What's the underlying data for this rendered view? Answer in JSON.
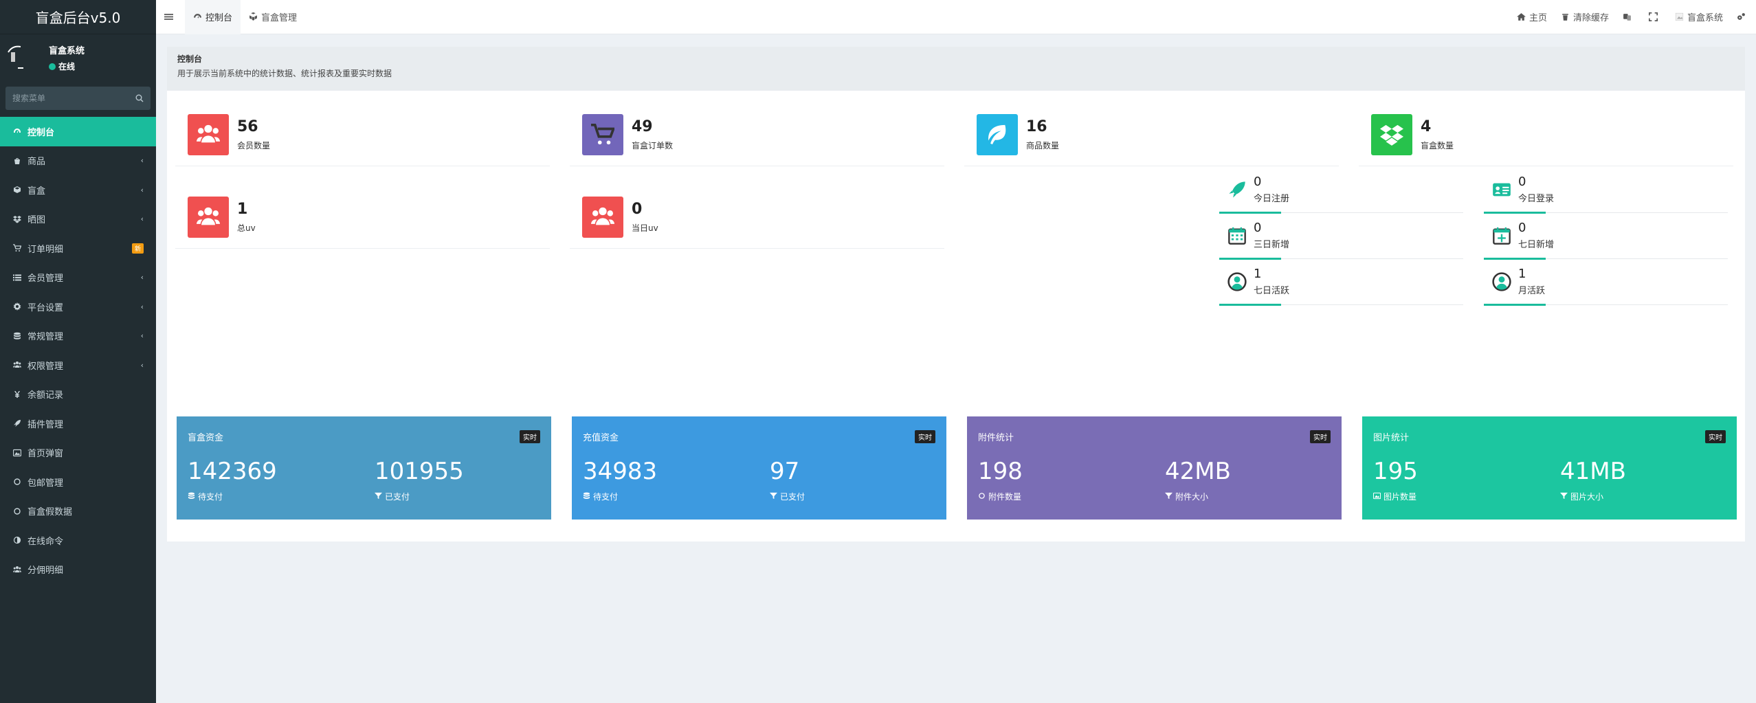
{
  "app": {
    "title": "盲盒后台v5.0"
  },
  "user": {
    "name": "盲盒系统",
    "status": "在线"
  },
  "search": {
    "placeholder": "搜索菜单"
  },
  "sidebar": {
    "items": [
      {
        "label": "控制台",
        "icon": "dashboard-icon",
        "active": true
      },
      {
        "label": "商品",
        "icon": "shopping-bag-icon",
        "has_children": true
      },
      {
        "label": "盲盒",
        "icon": "cube-icon",
        "has_children": true
      },
      {
        "label": "晒图",
        "icon": "dropbox-icon",
        "has_children": true
      },
      {
        "label": "订单明细",
        "icon": "cart-icon",
        "badge": "新"
      },
      {
        "label": "会员管理",
        "icon": "list-icon",
        "has_children": true
      },
      {
        "label": "平台设置",
        "icon": "gear-icon",
        "has_children": true
      },
      {
        "label": "常规管理",
        "icon": "database-icon",
        "has_children": true
      },
      {
        "label": "权限管理",
        "icon": "users-icon",
        "has_children": true
      },
      {
        "label": "余额记录",
        "icon": "yen-icon"
      },
      {
        "label": "插件管理",
        "icon": "rocket-icon"
      },
      {
        "label": "首页弹窗",
        "icon": "image-icon"
      },
      {
        "label": "包邮管理",
        "icon": "circle-icon"
      },
      {
        "label": "盲盒假数据",
        "icon": "circle-icon"
      },
      {
        "label": "在线命令",
        "icon": "half-circle-icon"
      },
      {
        "label": "分佣明细",
        "icon": "users-icon"
      }
    ]
  },
  "topbar": {
    "tabs": [
      {
        "label": "控制台",
        "icon": "dashboard-icon",
        "active": true
      },
      {
        "label": "盲盒管理",
        "icon": "cubes-icon"
      }
    ],
    "home_label": "主页",
    "clear_cache_label": "清除缓存",
    "user_label": "盲盒系统"
  },
  "page": {
    "title": "控制台",
    "description": "用于展示当前系统中的统计数据、统计报表及重要实时数据"
  },
  "stats": [
    {
      "value": "56",
      "label": "会员数量",
      "color": "#f05050",
      "icon": "users-icon"
    },
    {
      "value": "49",
      "label": "盲盒订单数",
      "color": "#7266ba",
      "icon": "cart-icon"
    },
    {
      "value": "16",
      "label": "商品数量",
      "color": "#23b7e5",
      "icon": "leaf-icon"
    },
    {
      "value": "4",
      "label": "盲盒数量",
      "color": "#27c24c",
      "icon": "dropbox-icon"
    },
    {
      "value": "1",
      "label": "总uv",
      "color": "#f05050",
      "icon": "users-icon"
    },
    {
      "value": "0",
      "label": "当日uv",
      "color": "#f05050",
      "icon": "users-icon"
    }
  ],
  "mini_stats": [
    {
      "value": "0",
      "label": "今日注册",
      "icon": "rocket-icon"
    },
    {
      "value": "0",
      "label": "今日登录",
      "icon": "id-card-icon"
    },
    {
      "value": "0",
      "label": "三日新增",
      "icon": "calendar-icon"
    },
    {
      "value": "0",
      "label": "七日新增",
      "icon": "calendar-plus-icon"
    },
    {
      "value": "1",
      "label": "七日活跃",
      "icon": "user-circle-icon"
    },
    {
      "value": "1",
      "label": "月活跃",
      "icon": "user-circle-icon"
    }
  ],
  "cards": [
    {
      "title": "盲盒资金",
      "tag": "实时",
      "color": "#4b9bc5",
      "v1": "142369",
      "l1": "待支付",
      "v2": "101955",
      "l2": "已支付"
    },
    {
      "title": "充值资金",
      "tag": "实时",
      "color": "#3d9ae0",
      "v1": "34983",
      "l1": "待支付",
      "v2": "97",
      "l2": "已支付"
    },
    {
      "title": "附件统计",
      "tag": "实时",
      "color": "#7a6db5",
      "v1": "198",
      "l1": "附件数量",
      "v2": "42MB",
      "l2": "附件大小"
    },
    {
      "title": "图片统计",
      "tag": "实时",
      "color": "#1cc6a0",
      "v1": "195",
      "l1": "图片数量",
      "v2": "41MB",
      "l2": "图片大小"
    }
  ]
}
